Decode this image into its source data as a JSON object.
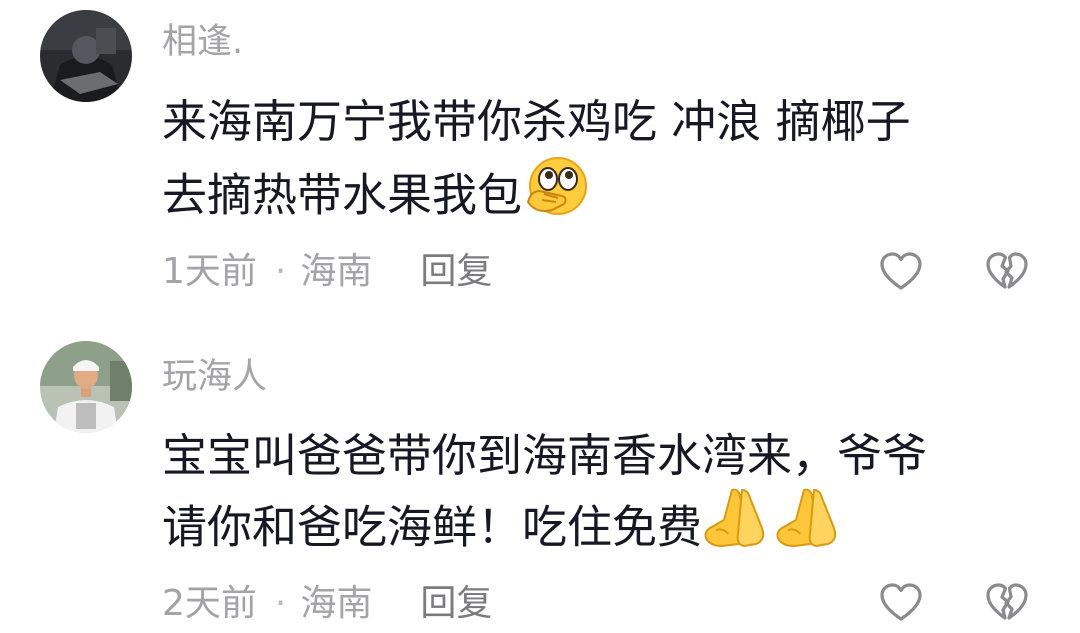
{
  "comments": [
    {
      "username": "相逢.",
      "content_line1": "来海南万宁我带你杀鸡吃  冲浪  摘椰子",
      "content_line2": "去摘热带水果我包",
      "content_emoji": "face-with-hand-over-mouth-peeking",
      "time": "1天前",
      "separator": "·",
      "location": "海南",
      "reply_label": "回复"
    },
    {
      "username": "玩海人",
      "content_line1": "宝宝叫爸爸带你到海南香水湾来，爷爷",
      "content_line2": "请你和爸吃海鲜！吃住免费",
      "content_emoji": "folded-hands",
      "time": "2天前",
      "separator": "·",
      "location": "海南",
      "reply_label": "回复"
    }
  ],
  "colors": {
    "username": "#a3a3a8",
    "text": "#161823",
    "meta": "#a3a3a8",
    "reply": "#7b7b80",
    "icon": "#8a8a8f"
  },
  "icons": [
    "like-heart-icon",
    "dislike-broken-heart-icon"
  ]
}
